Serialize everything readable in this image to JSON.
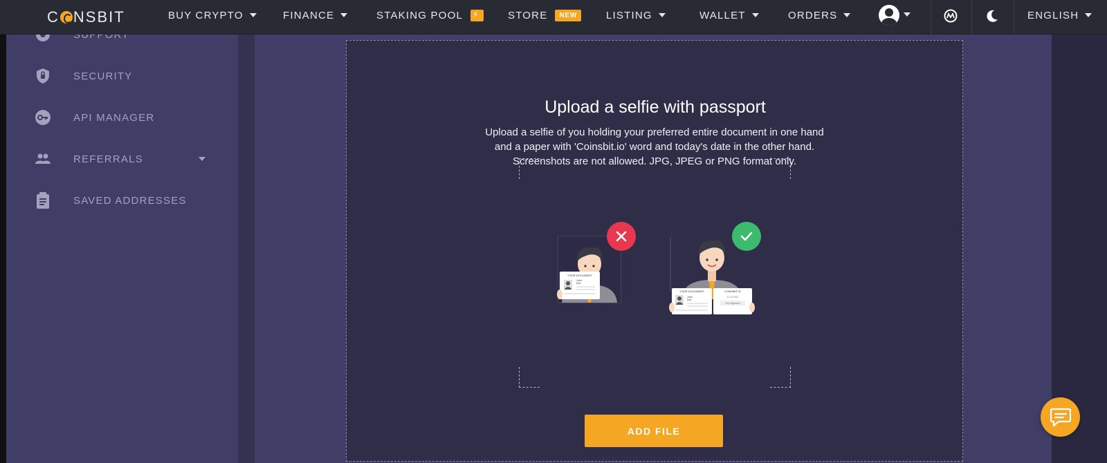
{
  "brand": {
    "logo_text_pre": "C",
    "logo_text_post": "NSBIT"
  },
  "nav": {
    "buy_crypto": "BUY CRYPTO",
    "finance": "FINANCE",
    "staking_pool": "STAKING POOL",
    "store": "STORE",
    "store_badge": "NEW",
    "listing": "LISTING",
    "wallet": "WALLET",
    "orders": "ORDERS",
    "language": "ENGLISH"
  },
  "sidebar": {
    "items": [
      {
        "label": "SUPPORT",
        "icon": "support-icon"
      },
      {
        "label": "SECURITY",
        "icon": "shield-icon"
      },
      {
        "label": "API MANAGER",
        "icon": "key-icon"
      },
      {
        "label": "REFERRALS",
        "icon": "people-icon"
      },
      {
        "label": "SAVED ADDRESSES",
        "icon": "clipboard-icon"
      }
    ]
  },
  "upload": {
    "title": "Upload a selfie with passport",
    "description": "Upload a selfie of you holding your preferred entire document in one hand and a paper with 'Coinsbit.io' word and today's date in the other hand. Screenshots are not allowed. JPG, JPEG or PNG format only.",
    "add_file_label": "ADD FILE",
    "wrong_doc_label": "YOUR DOCUMENT",
    "right_doc_label": "YOUR DOCUMENT",
    "right_paper_label": "COINSBIT.IO",
    "right_paper_date": "11.12.2021",
    "right_paper_sign": "Your Signature",
    "card_name_first": "John",
    "card_name_last": "Doe"
  },
  "colors": {
    "accent": "#f5a623",
    "error": "#e8384f",
    "success": "#3cba6d",
    "panel": "#302d48",
    "sidebar": "#403d66"
  }
}
